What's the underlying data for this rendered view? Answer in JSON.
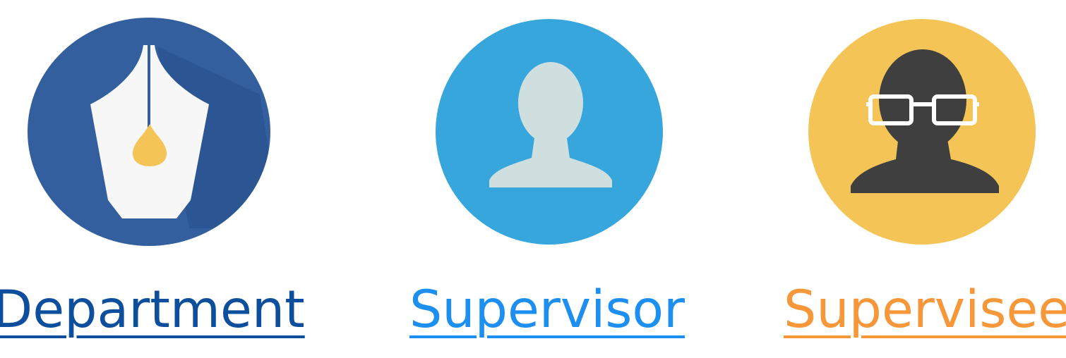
{
  "items": [
    {
      "label": "Department",
      "icon": "fountain-pen-nib-icon",
      "color": "#0d4f9c",
      "circle_color": "#335f9f"
    },
    {
      "label": "Supervisor",
      "icon": "user-silhouette-icon",
      "color": "#1c8ff0",
      "circle_color": "#36a6dc"
    },
    {
      "label": "Supervisee",
      "icon": "user-glasses-icon",
      "color": "#f6973a",
      "circle_color": "#f4c457"
    }
  ]
}
